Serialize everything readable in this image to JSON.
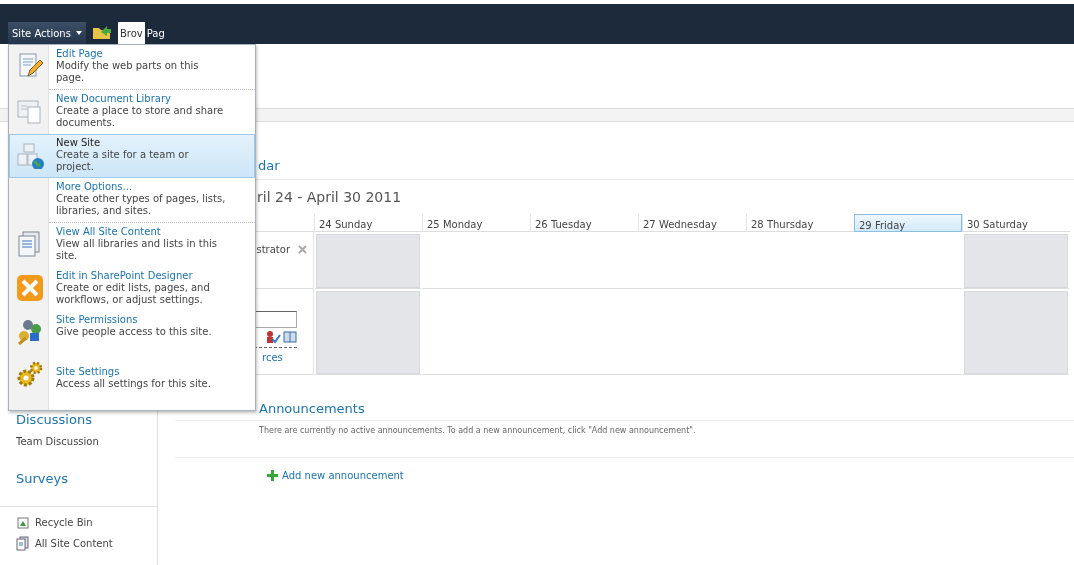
{
  "top_bar": {
    "site_actions": "Site Actions",
    "tabs": [
      {
        "label": "Brov",
        "selected": true
      },
      {
        "label": "Pag",
        "selected": false
      }
    ]
  },
  "site_actions_menu": {
    "items": [
      {
        "title": "Edit Page",
        "description": "Modify the web parts on this page.",
        "selected": false,
        "separator_after": true
      },
      {
        "title": "New Document Library",
        "description": "Create a place to store and share documents.",
        "selected": false,
        "separator_after": false
      },
      {
        "title": "New Site",
        "description": "Create a site for a team or project.",
        "selected": true,
        "separator_after": false
      },
      {
        "title": "More Options...",
        "description": "Create other types of pages, lists, libraries, and sites.",
        "selected": false,
        "separator_after": true
      },
      {
        "title": "View All Site Content",
        "description": "View all libraries and lists in this site.",
        "selected": false,
        "separator_after": false
      },
      {
        "title": "Edit in SharePoint Designer",
        "description": "Create or edit lists, pages, and workflows, or adjust settings.",
        "selected": false,
        "separator_after": false
      },
      {
        "title": "Site Permissions",
        "description": "Give people access to this site.",
        "selected": false,
        "separator_after": false
      },
      {
        "title": "Site Settings",
        "description": "Access all settings for this site.",
        "selected": false,
        "separator_after": false
      }
    ]
  },
  "left_nav": {
    "sections": [
      {
        "heading": "Discussions",
        "items": [
          "Team Discussion"
        ]
      },
      {
        "heading": "Surveys"
      }
    ],
    "bottom_links": [
      "Recycle Bin",
      "All Site Content"
    ]
  },
  "calendar": {
    "title": "dar",
    "range": "ril 24 - April 30 2011",
    "days": [
      {
        "label": "24 Sunday",
        "selected": false,
        "shaded": true
      },
      {
        "label": "25 Monday",
        "selected": false,
        "shaded": false
      },
      {
        "label": "26 Tuesday",
        "selected": false,
        "shaded": false
      },
      {
        "label": "27 Wednesday",
        "selected": false,
        "shaded": false
      },
      {
        "label": "28 Thursday",
        "selected": false,
        "shaded": false
      },
      {
        "label": "29 Friday",
        "selected": true,
        "shaded": false
      },
      {
        "label": "30 Saturday",
        "selected": false,
        "shaded": true
      }
    ],
    "rows": [
      {
        "label": "strator"
      },
      {
        "link": "rces"
      }
    ]
  },
  "announcements": {
    "title": "Announcements",
    "message": "There are currently no active announcements. To add a new announcement, click \"Add new announcement\".",
    "add_link": "Add new announcement"
  }
}
